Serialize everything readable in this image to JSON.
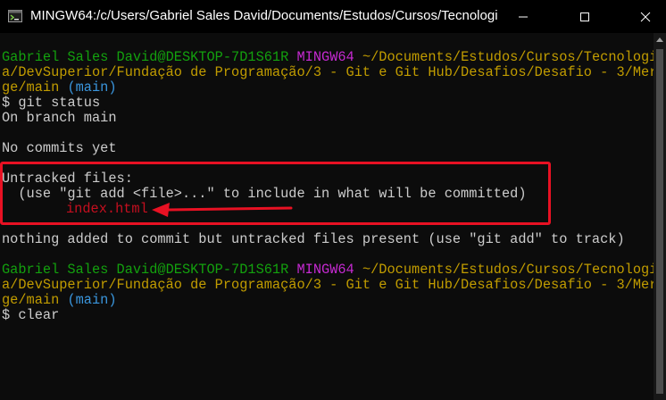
{
  "window": {
    "title": "MINGW64:/c/Users/Gabriel Sales David/Documents/Estudos/Cursos/Tecnologi",
    "app_icon": "mingw-terminal-icon",
    "controls": {
      "minimize": "minimize-icon",
      "maximize": "maximize-icon",
      "close": "close-icon"
    }
  },
  "terminal": {
    "prompt1": {
      "user": "Gabriel Sales David@DESKTOP-7D1S61R",
      "env": "MINGW64",
      "path_part1": "~/Documents/Estudos/Cursos/Tecnologi",
      "path_part2": "a/DevSuperior/Fundação de Programação/3 - Git e Git Hub/Desafios/Desafio - 3/Mer",
      "path_part3": "ge/main",
      "branch": "(main)",
      "symbol": "$",
      "command": "git status"
    },
    "output": {
      "on_branch": "On branch main",
      "no_commits": "No commits yet",
      "untracked_header": "Untracked files:",
      "untracked_hint": "  (use \"git add <file>...\" to include in what will be committed)",
      "untracked_file": "index.html",
      "nothing_added": "nothing added to commit but untracked files present (use \"git add\" to track)"
    },
    "prompt2": {
      "user": "Gabriel Sales David@DESKTOP-7D1S61R",
      "env": "MINGW64",
      "path_part1": "~/Documents/Estudos/Cursos/Tecnologi",
      "path_part2": "a/DevSuperior/Fundação de Programação/3 - Git e Git Hub/Desafios/Desafio - 3/Mer",
      "path_part3": "ge/main",
      "branch": "(main)",
      "symbol": "$",
      "command": "clear"
    }
  },
  "annotation": {
    "box_color": "#e81123",
    "arrow_color": "#e81123"
  },
  "colors": {
    "background": "#0c0c0c",
    "green": "#13a10e",
    "magenta": "#c62ad2",
    "yellow": "#c19c00",
    "cyan": "#3a96dd",
    "red": "#c50f1f",
    "text": "#cccccc"
  }
}
